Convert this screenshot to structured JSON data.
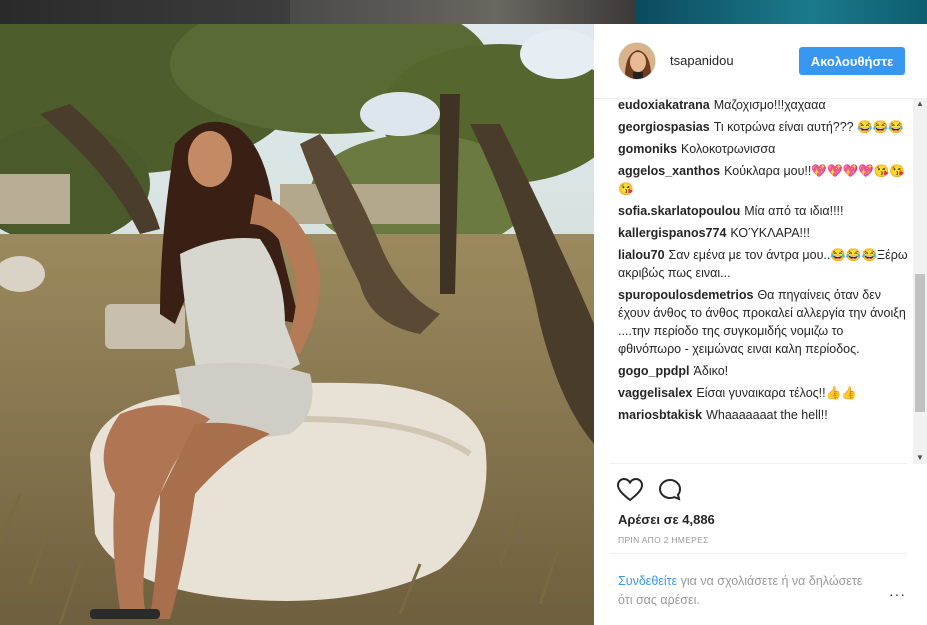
{
  "post": {
    "username": "tsapanidou",
    "follow_label": "Ακολουθήστε",
    "likes_text": "Αρέσει σε 4,886",
    "time_text": "ΠΡΙΝ ΑΠΟ 2 ΗΜΕΡΕΣ",
    "login_link": "Συνδεθείτε",
    "login_text": " για να σχολιάσετε ή να δηλώσετε ότι σας αρέσει.",
    "more_label": "···"
  },
  "comments": [
    {
      "user": "eudoxiakatrana",
      "text": "Μαζοχισμο!!!χαχααα"
    },
    {
      "user": "georgiospasias",
      "text": "Τι κοτρώνα είναι αυτή??? 😂😂😂"
    },
    {
      "user": "gomoniks",
      "text": "Κολοκοτρωνισσα"
    },
    {
      "user": "aggelos_xanthos",
      "text": "Κούκλαρα μου!!💖💖💖💖😘😘😘"
    },
    {
      "user": "sofia.skarlatopoulou",
      "text": "Μία από τα ιδια!!!!"
    },
    {
      "user": "kallergispanos774",
      "text": "ΚΟΎΚΛΑΡΑ!!!"
    },
    {
      "user": "lialou70",
      "text": "Σαν εμένα με τον άντρα μου..😂😂😂Ξέρω ακριβώς πως ειναι..."
    },
    {
      "user": "spuropoulosdemetrios",
      "text": "Θα πηγαίνεις όταν δεν έχουν άνθος το άνθος προκαλεί αλλεργία την άνοιξη ....την περίοδο της συγκομιδής νομιζω το φθινόπωρο - χειμώνας ειναι καλη περίοδος."
    },
    {
      "user": "gogo_ppdpl",
      "text": "Άδικο!"
    },
    {
      "user": "vaggelisalex",
      "text": "Είσαι γυναικαρα τέλος!!👍👍"
    },
    {
      "user": "mariosbtakisk",
      "text": "Whaaaaaaat the hell!!"
    }
  ],
  "icons": {
    "like": "heart-icon",
    "comment": "comment-bubble-icon",
    "more": "more-dots-icon"
  },
  "colors": {
    "accent": "#3897f0",
    "text": "#262626",
    "muted": "#999999"
  }
}
